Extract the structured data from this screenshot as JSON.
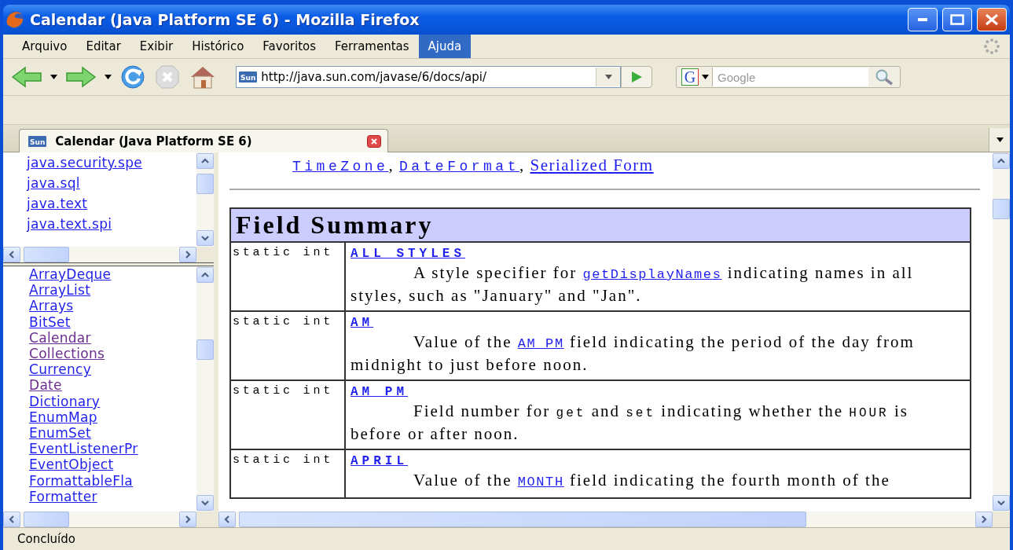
{
  "window": {
    "title": "Calendar (Java Platform SE 6) - Mozilla Firefox"
  },
  "menu": [
    {
      "label": "Arquivo",
      "selected": false
    },
    {
      "label": "Editar",
      "selected": false
    },
    {
      "label": "Exibir",
      "selected": false
    },
    {
      "label": "Histórico",
      "selected": false
    },
    {
      "label": "Favoritos",
      "selected": false
    },
    {
      "label": "Ferramentas",
      "selected": false
    },
    {
      "label": "Ajuda",
      "selected": true
    }
  ],
  "toolbar": {
    "site_badge": "Sun",
    "url": "http://java.sun.com/javase/6/docs/api/",
    "search_engine": "G",
    "search_placeholder": "Google"
  },
  "tabs": [
    {
      "badge": "Sun",
      "label": "Calendar (Java Platform SE 6)",
      "selected": true
    }
  ],
  "packages": [
    {
      "label": "java.security.spe",
      "visited": false
    },
    {
      "label": "java.sql",
      "visited": false
    },
    {
      "label": "java.text",
      "visited": false
    },
    {
      "label": "java.text.spi",
      "visited": false
    }
  ],
  "classes": [
    {
      "label": "ArrayDeque",
      "visited": false
    },
    {
      "label": "ArrayList",
      "visited": false
    },
    {
      "label": "Arrays",
      "visited": false
    },
    {
      "label": "BitSet",
      "visited": false
    },
    {
      "label": "Calendar",
      "visited": true
    },
    {
      "label": "Collections",
      "visited": true
    },
    {
      "label": "Currency",
      "visited": false
    },
    {
      "label": "Date",
      "visited": true
    },
    {
      "label": "Dictionary",
      "visited": false
    },
    {
      "label": "EnumMap",
      "visited": false
    },
    {
      "label": "EnumSet",
      "visited": false
    },
    {
      "label": "EventListenerPr",
      "visited": false
    },
    {
      "label": "EventObject",
      "visited": false
    },
    {
      "label": "FormattableFla",
      "visited": false
    },
    {
      "label": "Formatter",
      "visited": false
    }
  ],
  "content": {
    "see_also": [
      {
        "text": "TimeZone",
        "kind": "code_link"
      },
      {
        "text": ", ",
        "kind": "text"
      },
      {
        "text": "DateFormat",
        "kind": "code_link"
      },
      {
        "text": ", ",
        "kind": "text"
      },
      {
        "text": "Serialized Form",
        "kind": "link"
      }
    ],
    "summary_title": "Field Summary",
    "fields": [
      {
        "modifier": "static int",
        "name": "ALL_STYLES",
        "description": [
          {
            "kind": "text",
            "text": "A style specifier for "
          },
          {
            "kind": "code_link",
            "text": "getDisplayNames"
          },
          {
            "kind": "text",
            "text": " indicating names in all styles, such as \"January\" and \"Jan\"."
          }
        ]
      },
      {
        "modifier": "static int",
        "name": "AM",
        "description": [
          {
            "kind": "text",
            "text": "Value of the "
          },
          {
            "kind": "code_link",
            "text": "AM_PM"
          },
          {
            "kind": "text",
            "text": " field indicating the period of the day from midnight to just before noon."
          }
        ]
      },
      {
        "modifier": "static int",
        "name": "AM_PM",
        "description": [
          {
            "kind": "text",
            "text": "Field number for "
          },
          {
            "kind": "code",
            "text": "get"
          },
          {
            "kind": "text",
            "text": " and "
          },
          {
            "kind": "code",
            "text": "set"
          },
          {
            "kind": "text",
            "text": " indicating whether the "
          },
          {
            "kind": "code",
            "text": "HOUR"
          },
          {
            "kind": "text",
            "text": " is before or after noon."
          }
        ]
      },
      {
        "modifier": "static int",
        "name": "APRIL",
        "description": [
          {
            "kind": "text",
            "text": "Value of the "
          },
          {
            "kind": "code_link",
            "text": "MONTH"
          },
          {
            "kind": "text",
            "text": " field indicating the fourth month of the"
          }
        ]
      }
    ]
  },
  "status_bar": "Concluído"
}
